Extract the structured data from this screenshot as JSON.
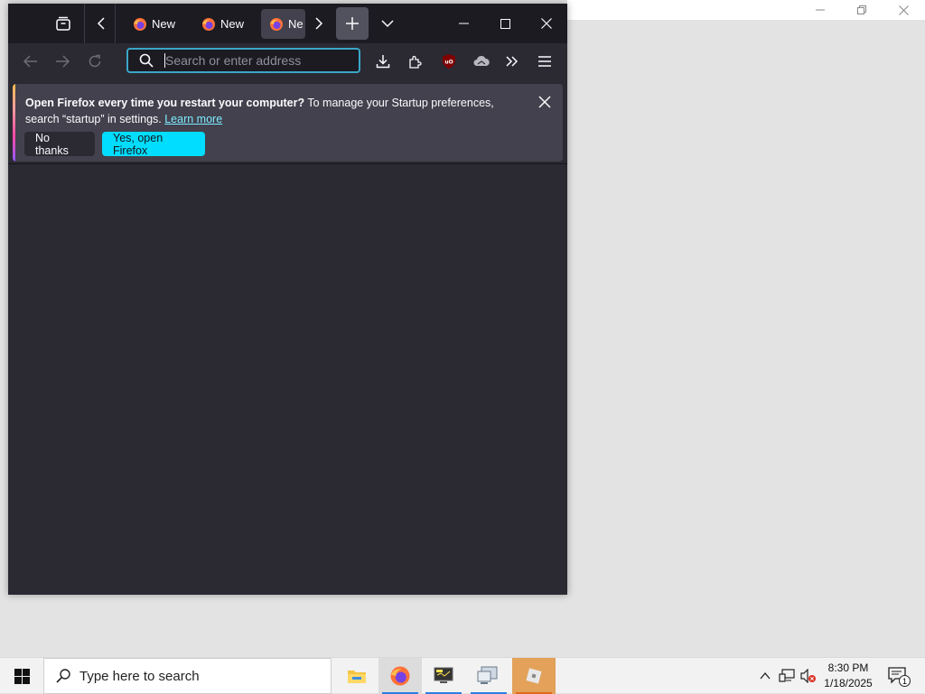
{
  "background_window": {
    "controls": [
      "minimize",
      "restore",
      "close"
    ]
  },
  "firefox": {
    "tabs": [
      {
        "label": "New",
        "icon": "firefox-icon"
      },
      {
        "label": "New",
        "icon": "firefox-icon"
      },
      {
        "label": "Ne",
        "icon": "firefox-icon",
        "active": true
      }
    ],
    "window_controls": [
      "minimize",
      "maximize",
      "close"
    ],
    "url_placeholder": "Search or enter address",
    "notification": {
      "bold": "Open Firefox every time you restart your computer?",
      "text": " To manage your Startup preferences, search “startup” in settings. ",
      "link": "Learn more",
      "no_label": "No thanks",
      "yes_label": "Yes, open Firefox"
    },
    "accent_color": "#00ddff"
  },
  "taskbar": {
    "search_placeholder": "Type here to search",
    "apps": [
      "file-explorer-icon",
      "firefox-icon",
      "monitor-app-icon",
      "computer-app-icon",
      "roblox-icon"
    ],
    "clock": {
      "time": "8:30 PM",
      "date": "1/18/2025"
    },
    "notification_count": "1"
  }
}
